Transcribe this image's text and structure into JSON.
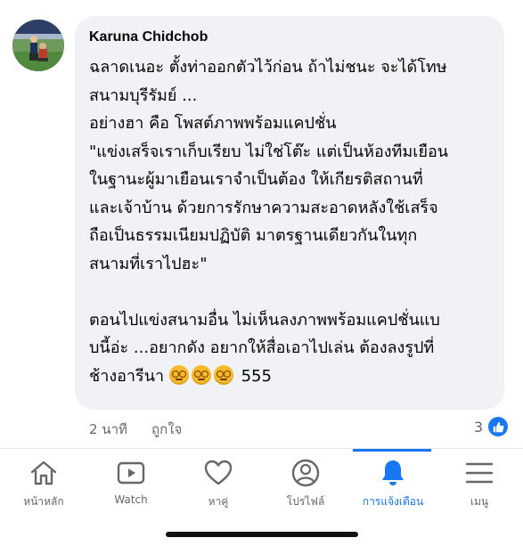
{
  "comment": {
    "author": "Karuna Chidchob",
    "lines": [
      "ฉลาดเนอะ ตั้งท่าออกตัวไว้ก่อน ถ้าไม่ชนะ จะได้โทษ",
      "สนามบุรีรัมย์ ...",
      "อย่างฮา คือ โพสต์ภาพพร้อมแคปชั่น",
      "\"แข่งเสร็จเราเก็บเรียบ ไม่ใช่โต๊ะ แต่เป็นห้องทีมเยือน",
      "ในฐานะผู้มาเยือนเราจำเป็นต้อง ให้เกียรติสถานที่",
      "และเจ้าบ้าน ด้วยการรักษาความสะอาดหลังใช้เสร็จ",
      "ถือเป็นธรรมเนียมปฏิบัติ มาตรฐานเดียวกันในทุก",
      "สนามที่เราไปฮะ\"",
      "",
      "ตอนไปแข่งสนามอื่น ไม่เห็นลงภาพพร้อมแคปชั่นแบ",
      "บนี้อ่ะ ...อยากดัง อยากให้สื่อเอาไปเล่น ต้องลงรูปที่"
    ],
    "last_line_text": "ช้างอารีนา",
    "last_line_suffix": "555",
    "emoji_icons": [
      "dizzy-face-icon",
      "dizzy-face-icon",
      "dizzy-face-icon"
    ],
    "time": "2 นาที",
    "like_action": "ถูกใจ",
    "reaction_count": "3",
    "reaction_icon": "like-icon"
  },
  "nav": {
    "items": [
      {
        "label": "หน้าหลัก",
        "icon": "home-icon"
      },
      {
        "label": "Watch",
        "icon": "watch-video-icon"
      },
      {
        "label": "หาคู่",
        "icon": "heart-icon"
      },
      {
        "label": "โปรไฟล์",
        "icon": "profile-icon"
      },
      {
        "label": "การแจ้งเตือน",
        "icon": "bell-icon"
      },
      {
        "label": "เมนู",
        "icon": "menu-icon"
      }
    ],
    "active_index": 4
  },
  "colors": {
    "accent": "#1877f2",
    "bubble": "#f0f2f5",
    "text": "#050505",
    "muted": "#65676b",
    "emoji": "#f7b928"
  }
}
